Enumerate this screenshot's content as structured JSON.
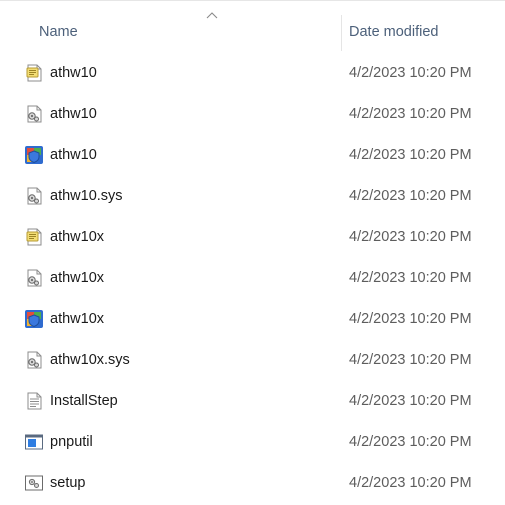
{
  "header": {
    "name_label": "Name",
    "date_label": "Date modified",
    "sort_icon": "chevron-up-icon"
  },
  "files": [
    {
      "name": "athw10",
      "date": "4/2/2023 10:20 PM",
      "icon": "setup-information-icon"
    },
    {
      "name": "athw10",
      "date": "4/2/2023 10:20 PM",
      "icon": "system-file-icon"
    },
    {
      "name": "athw10",
      "date": "4/2/2023 10:20 PM",
      "icon": "security-catalog-icon"
    },
    {
      "name": "athw10.sys",
      "date": "4/2/2023 10:20 PM",
      "icon": "system-file-icon"
    },
    {
      "name": "athw10x",
      "date": "4/2/2023 10:20 PM",
      "icon": "setup-information-icon"
    },
    {
      "name": "athw10x",
      "date": "4/2/2023 10:20 PM",
      "icon": "system-file-icon"
    },
    {
      "name": "athw10x",
      "date": "4/2/2023 10:20 PM",
      "icon": "security-catalog-icon"
    },
    {
      "name": "athw10x.sys",
      "date": "4/2/2023 10:20 PM",
      "icon": "system-file-icon"
    },
    {
      "name": "InstallStep",
      "date": "4/2/2023 10:20 PM",
      "icon": "text-document-icon"
    },
    {
      "name": "pnputil",
      "date": "4/2/2023 10:20 PM",
      "icon": "application-icon"
    },
    {
      "name": "setup",
      "date": "4/2/2023 10:20 PM",
      "icon": "batch-file-icon"
    }
  ]
}
